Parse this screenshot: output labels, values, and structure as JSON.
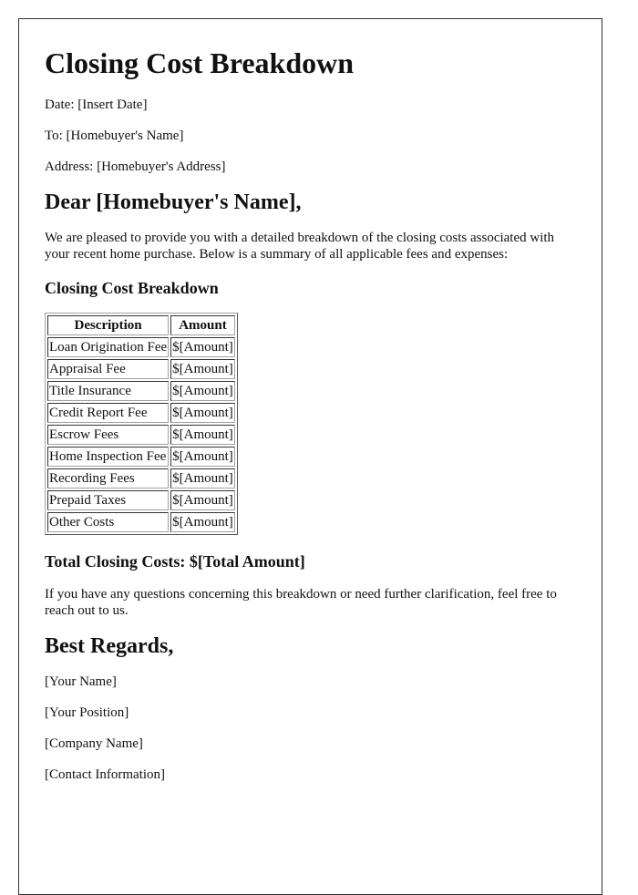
{
  "document": {
    "title": "Closing Cost Breakdown",
    "meta": {
      "date": "Date: [Insert Date]",
      "to": "To: [Homebuyer's Name]",
      "address": "Address: [Homebuyer's Address]"
    },
    "greeting": "Dear [Homebuyer's Name],",
    "intro": "We are pleased to provide you with a detailed breakdown of the closing costs associated with your recent home purchase. Below is a summary of all applicable fees and expenses:",
    "section_title": "Closing Cost Breakdown",
    "table": {
      "headers": [
        "Description",
        "Amount"
      ],
      "rows": [
        {
          "description": "Loan Origination Fee",
          "amount": "$[Amount]"
        },
        {
          "description": "Appraisal Fee",
          "amount": "$[Amount]"
        },
        {
          "description": "Title Insurance",
          "amount": "$[Amount]"
        },
        {
          "description": "Credit Report Fee",
          "amount": "$[Amount]"
        },
        {
          "description": "Escrow Fees",
          "amount": "$[Amount]"
        },
        {
          "description": "Home Inspection Fee",
          "amount": "$[Amount]"
        },
        {
          "description": "Recording Fees",
          "amount": "$[Amount]"
        },
        {
          "description": "Prepaid Taxes",
          "amount": "$[Amount]"
        },
        {
          "description": "Other Costs",
          "amount": "$[Amount]"
        }
      ]
    },
    "total": "Total Closing Costs: $[Total Amount]",
    "closing_paragraph": "If you have any questions concerning this breakdown or need further clarification, feel free to reach out to us.",
    "signoff": "Best Regards,",
    "signature": {
      "name": "[Your Name]",
      "position": "[Your Position]",
      "company": "[Company Name]",
      "contact": "[Contact Information]"
    }
  }
}
